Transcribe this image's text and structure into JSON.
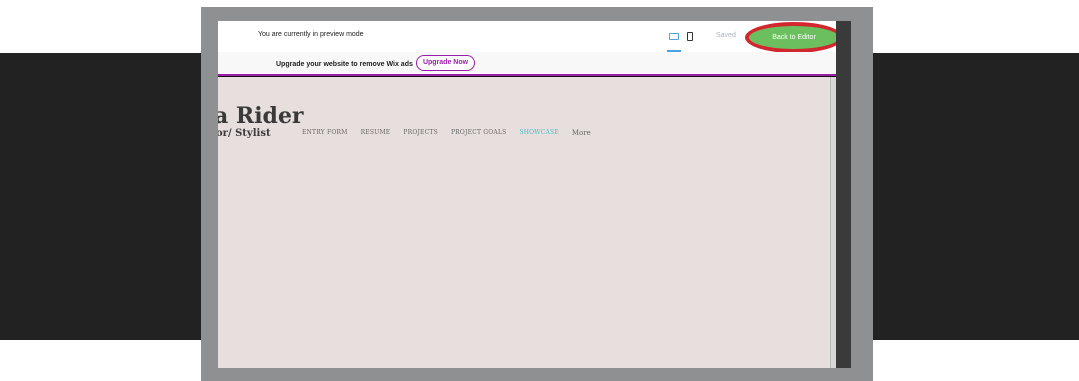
{
  "preview_bar": {
    "message": "You are currently in preview mode",
    "saved_label": "Saved",
    "back_to_editor_label": "Back to Editor"
  },
  "ad_bar": {
    "message": "Upgrade your website to remove Wix ads",
    "upgrade_label": "Upgrade Now"
  },
  "site": {
    "title": "a Rider",
    "subtitle": "or/ Stylist",
    "nav": [
      {
        "label": "ENTRY FORM"
      },
      {
        "label": "RESUME"
      },
      {
        "label": "PROJECTS"
      },
      {
        "label": "PROJECT GOALS"
      },
      {
        "label": "SHOWCASE",
        "active": true
      },
      {
        "label": "More"
      }
    ]
  },
  "colors": {
    "accent_purple": "#9b1ea8",
    "back_button_green": "#6bbf5e",
    "highlight_red": "#d2272e",
    "active_nav": "#4cb8c4",
    "site_bg": "#e7dfde"
  },
  "icons": [
    "desktop-icon",
    "mobile-icon",
    "expand-arrows-icon"
  ]
}
